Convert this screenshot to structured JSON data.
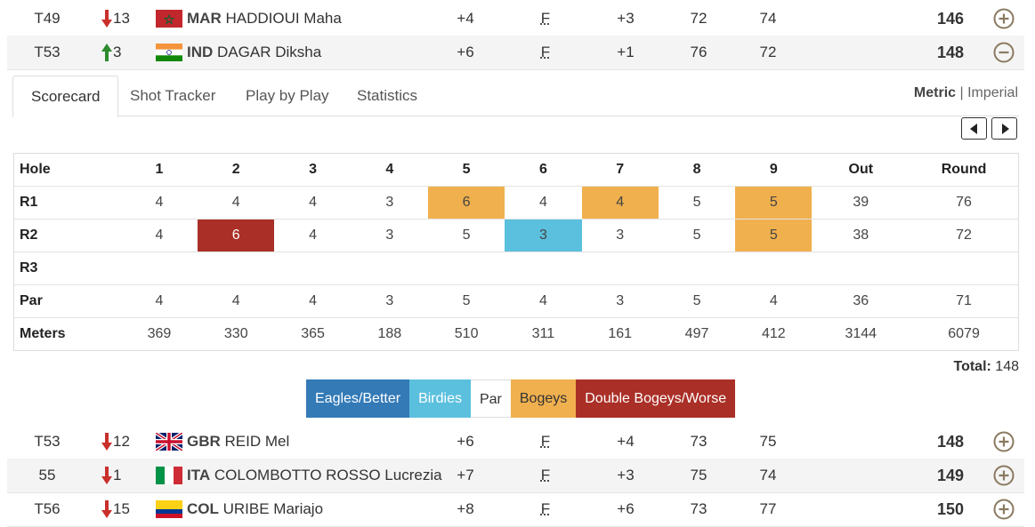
{
  "players_top": [
    {
      "pos": "T49",
      "move_dir": "down",
      "move": "13",
      "country": "MAR",
      "name": "HADDIOUI Maha",
      "total": "+4",
      "thru": "F",
      "today": "+3",
      "r1": "72",
      "r2": "74",
      "score": "146",
      "expand": "plus"
    },
    {
      "pos": "T53",
      "move_dir": "up",
      "move": "3",
      "country": "IND",
      "name": "DAGAR Diksha",
      "total": "+6",
      "thru": "F",
      "today": "+1",
      "r1": "76",
      "r2": "72",
      "score": "148",
      "expand": "minus"
    }
  ],
  "tabs": [
    "Scorecard",
    "Shot Tracker",
    "Play by Play",
    "Statistics"
  ],
  "units": {
    "metric": "Metric",
    "sep": "|",
    "imperial": "Imperial"
  },
  "scorecard": {
    "headers": [
      "Hole",
      "1",
      "2",
      "3",
      "4",
      "5",
      "6",
      "7",
      "8",
      "9",
      "Out",
      "Round"
    ],
    "rows": [
      {
        "label": "R1",
        "cells": [
          "4",
          "4",
          "4",
          "3",
          "6",
          "4",
          "4",
          "5",
          "5",
          "39",
          "76"
        ],
        "types": [
          "",
          "",
          "",
          "",
          "bogey",
          "",
          "bogey",
          "",
          "bogey",
          "",
          ""
        ]
      },
      {
        "label": "R2",
        "cells": [
          "4",
          "6",
          "4",
          "3",
          "5",
          "3",
          "3",
          "5",
          "5",
          "38",
          "72"
        ],
        "types": [
          "",
          "dbl",
          "",
          "",
          "",
          "birdie",
          "",
          "",
          "bogey",
          "",
          ""
        ]
      },
      {
        "label": "R3",
        "cells": [
          "",
          "",
          "",
          "",
          "",
          "",
          "",
          "",
          "",
          "",
          ""
        ],
        "types": [
          "",
          "",
          "",
          "",
          "",
          "",
          "",
          "",
          "",
          "",
          ""
        ]
      },
      {
        "label": "Par",
        "cells": [
          "4",
          "4",
          "4",
          "3",
          "5",
          "4",
          "3",
          "5",
          "4",
          "36",
          "71"
        ],
        "types": [
          "",
          "",
          "",
          "",
          "",
          "",
          "",
          "",
          "",
          "",
          ""
        ]
      },
      {
        "label": "Meters",
        "cells": [
          "369",
          "330",
          "365",
          "188",
          "510",
          "311",
          "161",
          "497",
          "412",
          "3144",
          "6079"
        ],
        "types": [
          "",
          "",
          "",
          "",
          "",
          "",
          "",
          "",
          "",
          "",
          ""
        ]
      }
    ]
  },
  "total": {
    "label": "Total:",
    "value": "148"
  },
  "legend": [
    {
      "label": "Eagles/Better",
      "color": "#337ab7"
    },
    {
      "label": "Birdies",
      "color": "#5bc0de"
    },
    {
      "label": "Par",
      "color": "#ffffff"
    },
    {
      "label": "Bogeys",
      "color": "#f0b04e"
    },
    {
      "label": "Double Bogeys/Worse",
      "color": "#aa2f26"
    }
  ],
  "players_bottom": [
    {
      "pos": "T53",
      "move_dir": "down",
      "move": "12",
      "country": "GBR",
      "name": "REID Mel",
      "total": "+6",
      "thru": "F",
      "today": "+4",
      "r1": "73",
      "r2": "75",
      "score": "148",
      "expand": "plus"
    },
    {
      "pos": "55",
      "move_dir": "down",
      "move": "1",
      "country": "ITA",
      "name": "COLOMBOTTO ROSSO Lucrezia",
      "total": "+7",
      "thru": "F",
      "today": "+3",
      "r1": "75",
      "r2": "74",
      "score": "149",
      "expand": "plus"
    },
    {
      "pos": "T56",
      "move_dir": "down",
      "move": "15",
      "country": "COL",
      "name": "URIBE Mariajo",
      "total": "+8",
      "thru": "F",
      "today": "+6",
      "r1": "73",
      "r2": "77",
      "score": "150",
      "expand": "plus"
    }
  ]
}
